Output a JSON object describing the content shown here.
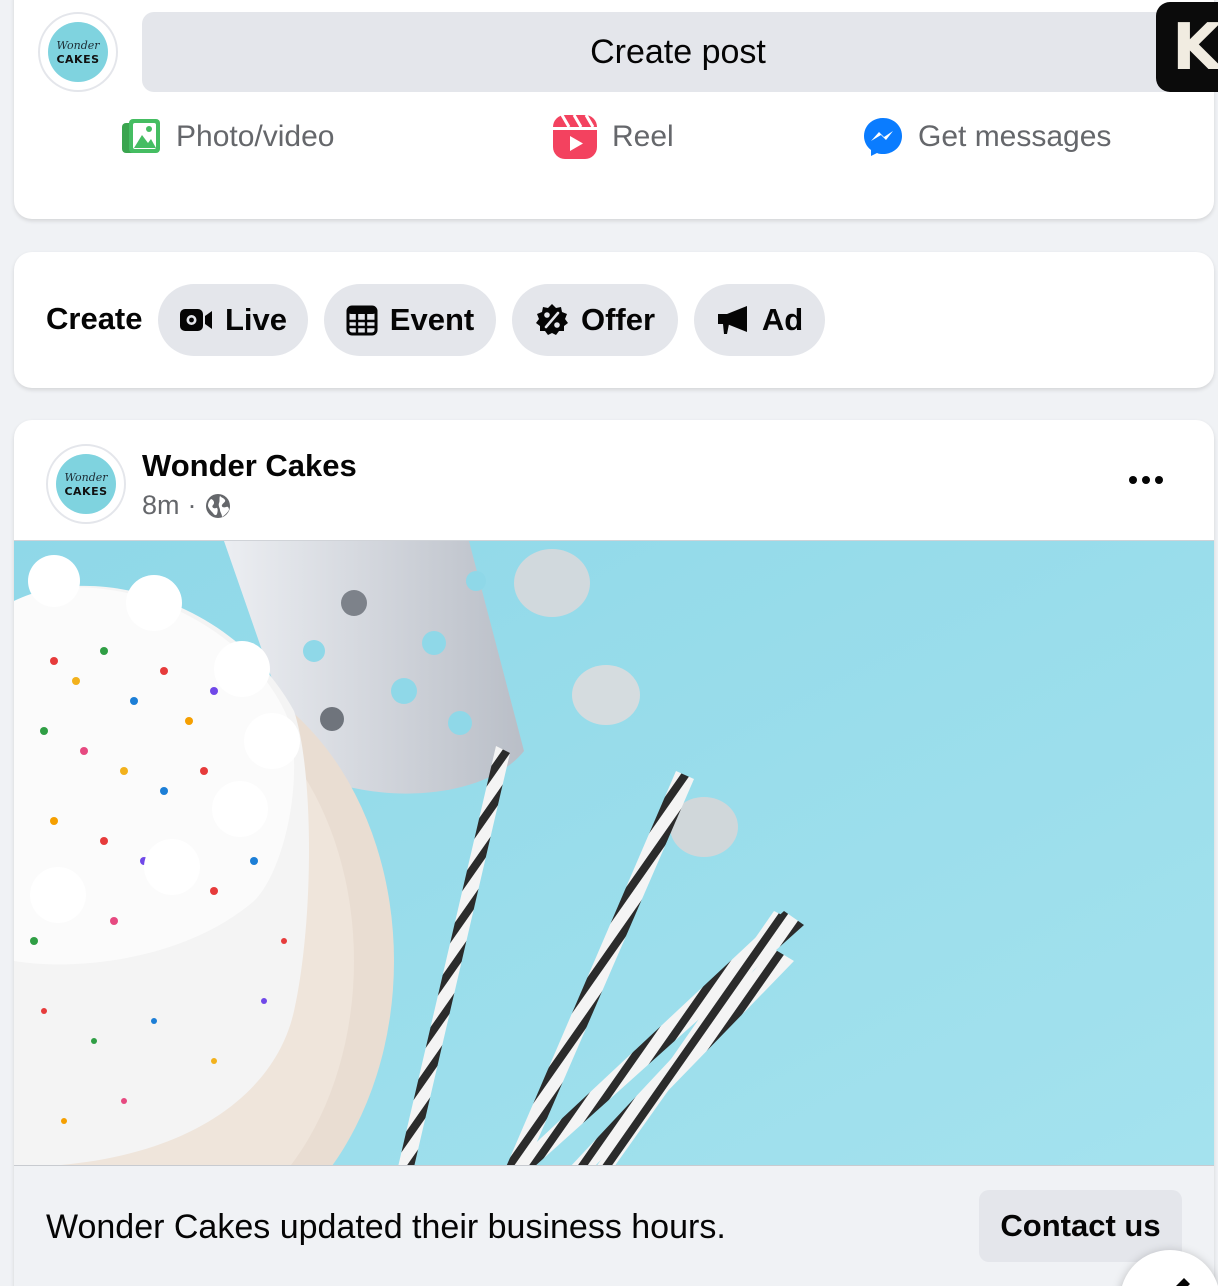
{
  "page": {
    "name": "Wonder Cakes",
    "avatar_text_script": "Wonder",
    "avatar_text_caps": "CAKES"
  },
  "composer": {
    "create_post_label": "Create post",
    "badge_letter": "K",
    "actions": [
      {
        "label": "Photo/video",
        "icon": "photo-icon"
      },
      {
        "label": "Reel",
        "icon": "reel-icon"
      },
      {
        "label": "Get messages",
        "icon": "messenger-icon"
      }
    ]
  },
  "create_row": {
    "label": "Create",
    "chips": [
      {
        "label": "Live",
        "icon": "video-camera-icon"
      },
      {
        "label": "Event",
        "icon": "calendar-icon"
      },
      {
        "label": "Offer",
        "icon": "percent-badge-icon"
      },
      {
        "label": "Ad",
        "icon": "megaphone-icon"
      }
    ]
  },
  "post": {
    "author": "Wonder Cakes",
    "time": "8m",
    "separator": "·",
    "audience_icon": "globe-icon",
    "more_icon": "more-dots-icon",
    "image_icon": "cake-photo",
    "footer_text": "Wonder Cakes updated their business hours.",
    "cta_label": "Contact us"
  },
  "colors": {
    "background": "#f0f2f5",
    "button_gray": "#e4e6eb",
    "secondary_text": "#65676b",
    "photo_green": "#45bd62",
    "reel_pink": "#f3425f",
    "messenger_blue": "#0a7cff",
    "image_sky": "#9fdfec"
  }
}
